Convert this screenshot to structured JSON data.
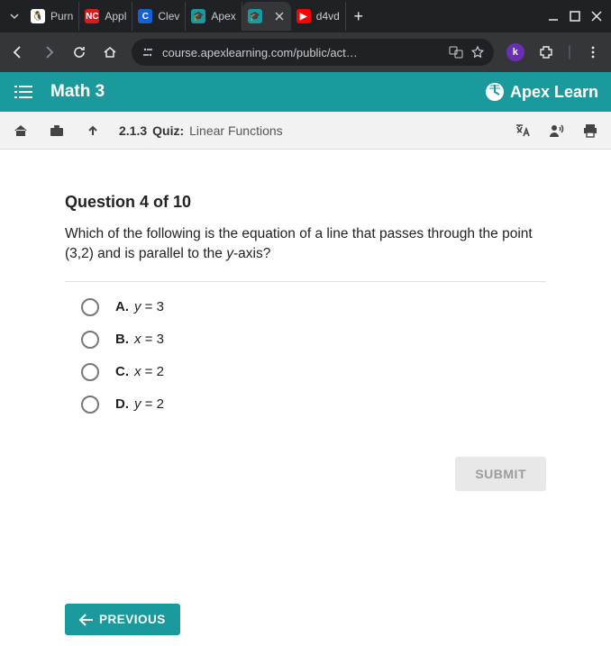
{
  "browser": {
    "tabs": [
      {
        "favicon": "🐧",
        "favbg": "#fff",
        "favcolor": "#000",
        "title": "Purn"
      },
      {
        "favicon": "NC",
        "favbg": "#d81b1b",
        "favcolor": "#fff",
        "title": "Appl"
      },
      {
        "favicon": "C",
        "favbg": "#1560d4",
        "favcolor": "#fff",
        "title": "Clev"
      },
      {
        "favicon": "🎓",
        "favbg": "#1b9a9d",
        "favcolor": "#fff",
        "title": "Apex"
      },
      {
        "favicon": "🎓",
        "favbg": "#1b9a9d",
        "favcolor": "#fff",
        "title": ""
      },
      {
        "favicon": "▶",
        "favbg": "#ff0000",
        "favcolor": "#fff",
        "title": "d4vd"
      }
    ],
    "active_tab_index": 4,
    "url": "course.apexlearning.com/public/act…",
    "ext_label": "k"
  },
  "apex": {
    "course_title": "Math 3",
    "brand": "Apex Learn"
  },
  "crumb": {
    "number": "2.1.3",
    "kind": "Quiz:",
    "title": "Linear Functions"
  },
  "question": {
    "counter": "Question 4 of 10",
    "prompt_before_y": "Which of the following is the equation of a line that passes through the point (3,2) and is parallel to the ",
    "prompt_y": "y",
    "prompt_after_y": "-axis?",
    "options": [
      {
        "letter": "A.",
        "var": "y",
        "rest": " = 3"
      },
      {
        "letter": "B.",
        "var": "x",
        "rest": " = 3"
      },
      {
        "letter": "C.",
        "var": "x",
        "rest": " = 2"
      },
      {
        "letter": "D.",
        "var": "y",
        "rest": " = 2"
      }
    ],
    "submit_label": "SUBMIT",
    "previous_label": "PREVIOUS"
  }
}
